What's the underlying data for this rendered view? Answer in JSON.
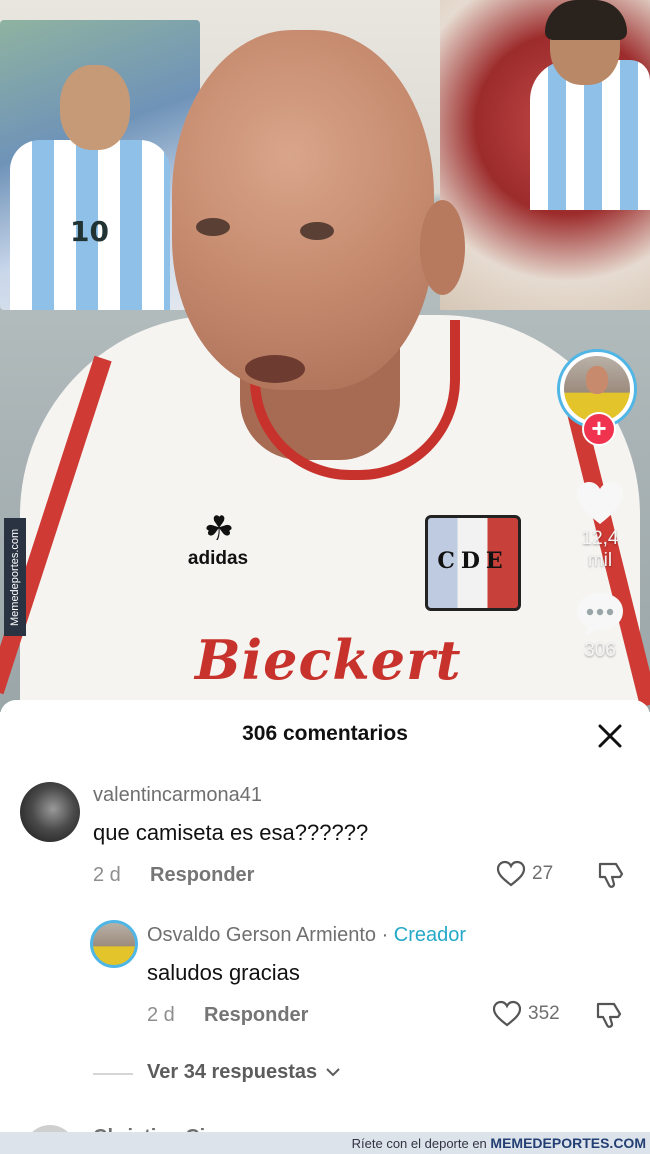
{
  "video": {
    "jersey_brand": "adidas",
    "crest_text": "CDE",
    "sponsor_text": "Bieckert",
    "poster_number": "10",
    "likes_count": "12,4 mil",
    "comments_count": "306",
    "side_watermark": "Memedeportes.com"
  },
  "sheet": {
    "title": "306 comentarios",
    "comments": [
      {
        "username": "valentincarmona41",
        "text": "que camiseta es esa??????",
        "age": "2 d",
        "reply_label": "Responder",
        "likes": "27"
      },
      {
        "username": "Osvaldo Gerson Armiento",
        "separator": "·",
        "badge": "Creador",
        "text": "saludos gracias",
        "age": "2 d",
        "reply_label": "Responder",
        "likes": "352"
      }
    ],
    "view_replies": "Ver 34 respuestas",
    "next_username_partial": "Christian Ci..."
  },
  "banner": {
    "prefix": "Ríete con el deporte en",
    "brand": "MEMEDEPORTES.COM"
  },
  "colors": {
    "accent_follow": "#f0344f",
    "creator_badge": "#25a9c8",
    "ring": "#4fb6e6"
  }
}
